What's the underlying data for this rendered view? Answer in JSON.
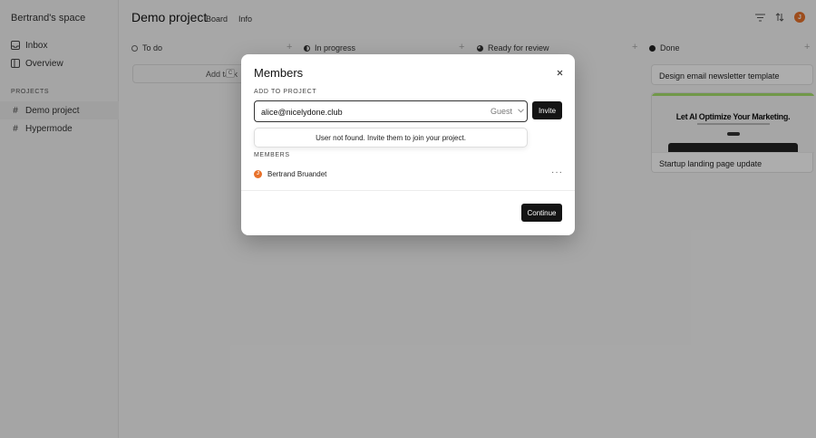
{
  "sidebar": {
    "space_name": "Bertrand's space",
    "items": [
      {
        "label": "Inbox",
        "icon": "inbox-icon"
      },
      {
        "label": "Overview",
        "icon": "overview-icon"
      }
    ],
    "section_label": "PROJECTS",
    "projects": [
      {
        "label": "Demo project",
        "icon": "hash-icon",
        "active": true
      },
      {
        "label": "Hypermode",
        "icon": "hash-icon",
        "active": false
      }
    ]
  },
  "header": {
    "title": "Demo project",
    "tabs": [
      {
        "label": "Board"
      },
      {
        "label": "Info"
      }
    ],
    "icons": [
      "filter-icon",
      "sort-icon",
      "user-avatar"
    ]
  },
  "board": {
    "columns": [
      {
        "label": "To do",
        "status": "todo"
      },
      {
        "label": "In progress",
        "status": "in-progress"
      },
      {
        "label": "Ready for review",
        "status": "review"
      },
      {
        "label": "Done",
        "status": "done"
      }
    ],
    "add_task_label": "Add task",
    "add_task_shortcut": "C",
    "done_cards": [
      {
        "title": "Design email newsletter template"
      },
      {
        "title": "Startup landing page update",
        "thumbnail_headline": "Let AI Optimize Your Marketing."
      }
    ]
  },
  "modal": {
    "title": "Members",
    "add_section_label": "ADD TO PROJECT",
    "email_value": "alice@nicelydone.club",
    "role_value": "Guest",
    "invite_label": "Invite",
    "dropdown_message": "User not found. Invite them to join your project.",
    "members_section_label": "MEMBERS",
    "members": [
      {
        "name": "Bertrand Bruandet"
      }
    ],
    "continue_label": "Continue"
  },
  "colors": {
    "accent_avatar": "#e8722b",
    "button_dark": "#141414",
    "thumbnail_bar": "#a7e06c"
  }
}
